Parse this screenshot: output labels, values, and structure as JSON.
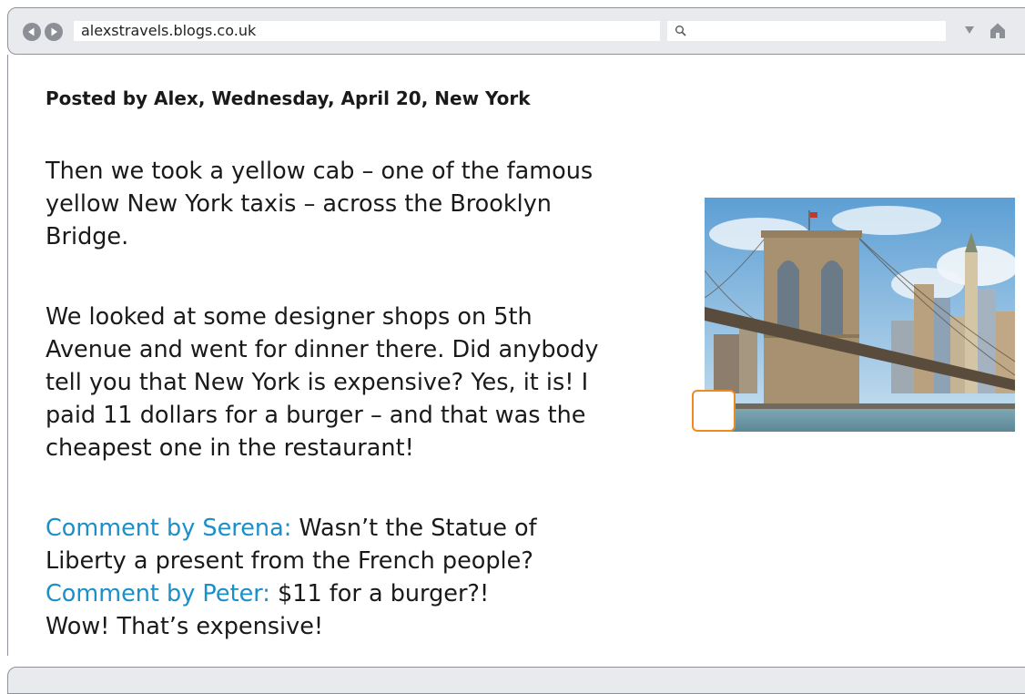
{
  "browser": {
    "url": "alexstravels.blogs.co.uk",
    "search_placeholder": "",
    "icons": [
      "back-icon",
      "forward-icon",
      "search-icon",
      "dropdown-arrow-icon",
      "home-icon"
    ]
  },
  "post": {
    "header": "Posted by Alex, Wednesday, April 20, New York",
    "paragraph1": [
      "Then we took a yellow cab – one of the famous",
      "yellow New York taxis – across the Brooklyn",
      "Bridge."
    ],
    "paragraph2": [
      "We looked at some designer shops on 5th",
      "Avenue and went for dinner there. Did anybody",
      "tell you that New York is expensive? Yes, it is! I",
      "paid 11 dollars for a burger – and that was the",
      "cheapest one in the restaurant!"
    ]
  },
  "comments": [
    {
      "author_label": "Comment by Serena:",
      "text_line1": " Wasn’t the Statue of",
      "text_line2": "Liberty a present from the French people?"
    },
    {
      "author_label": "Comment by Peter:",
      "text_line1": " $11 for a burger?!",
      "text_line2": "Wow! That’s expensive!"
    }
  ],
  "colors": {
    "comment_author": "#1a8fc9",
    "answer_box_border": "#ef8a1e",
    "toolbar_bg": "#e9eaee"
  }
}
